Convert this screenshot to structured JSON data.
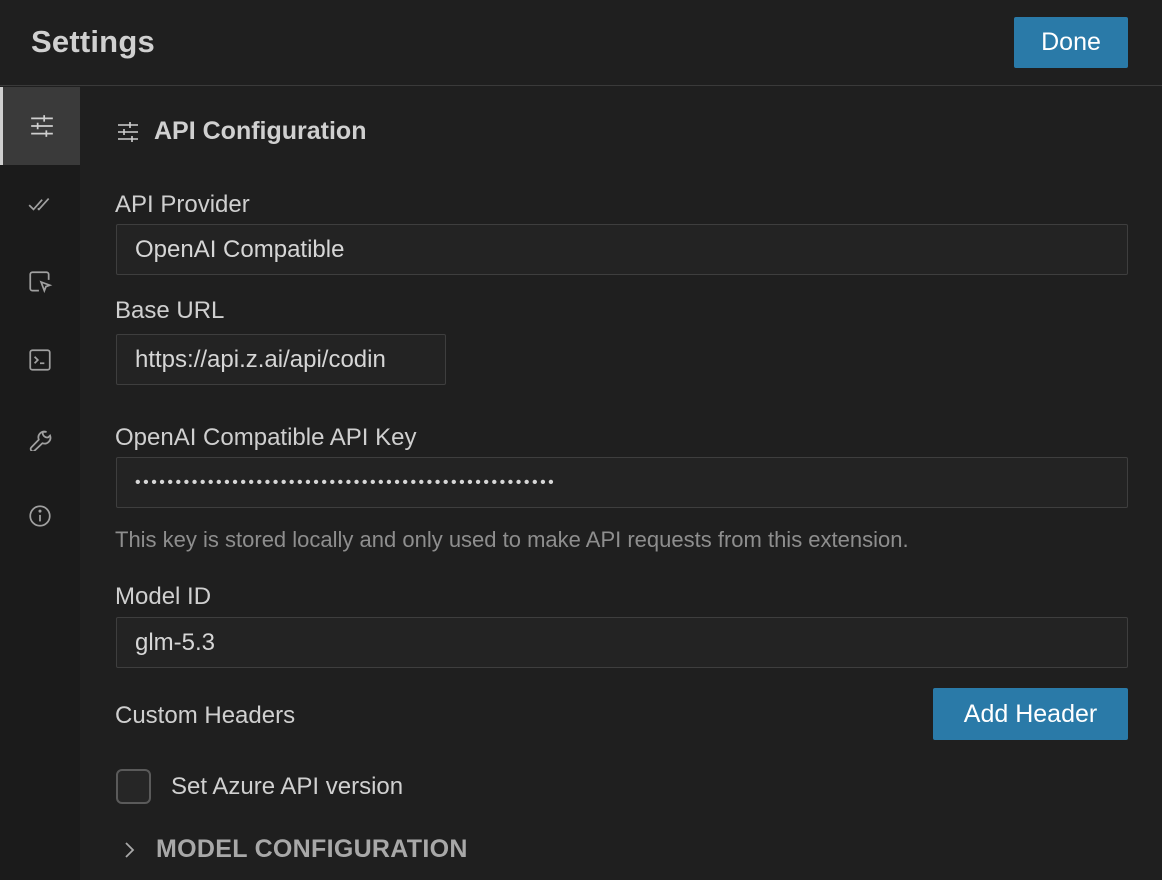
{
  "header": {
    "title": "Settings",
    "done_label": "Done"
  },
  "sidebar": {
    "items": [
      {
        "icon": "sliders-icon",
        "active": true
      },
      {
        "icon": "check-all-icon",
        "active": false
      },
      {
        "icon": "cursor-select-icon",
        "active": false
      },
      {
        "icon": "terminal-icon",
        "active": false
      },
      {
        "icon": "wrench-icon",
        "active": false
      },
      {
        "icon": "info-icon",
        "active": false
      }
    ]
  },
  "section": {
    "icon": "sliders-icon",
    "title": "API Configuration"
  },
  "form": {
    "provider": {
      "label": "API Provider",
      "value": "OpenAI Compatible"
    },
    "base_url": {
      "label": "Base URL",
      "value": "https://api.z.ai/api/codin"
    },
    "api_key": {
      "label": "OpenAI Compatible API Key",
      "value": "••••••••••••••••••••••••••••••••••••••••••••••••••••",
      "helper": "This key is stored locally and only used to make API requests from this extension."
    },
    "model_id": {
      "label": "Model ID",
      "value": "glm-5.3"
    },
    "custom_headers": {
      "label": "Custom Headers",
      "button_label": "Add Header"
    },
    "azure": {
      "label": "Set Azure API version",
      "checked": false
    },
    "model_config": {
      "label": "MODEL CONFIGURATION",
      "expanded": false
    }
  },
  "colors": {
    "accent": "#2a7aa8",
    "background": "#1f1f1f",
    "sidebar": "#1b1b1b"
  }
}
